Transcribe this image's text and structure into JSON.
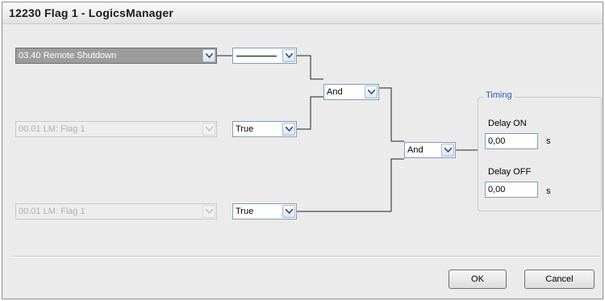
{
  "window": {
    "title": "12230 Flag 1 - LogicsManager"
  },
  "inputs": [
    {
      "value": "03.40 Remote Shutdown",
      "state": "selected"
    },
    {
      "value": "00.01 LM: Flag 1",
      "state": "disabled"
    },
    {
      "value": "00.01 LM: Flag 1",
      "state": "disabled"
    }
  ],
  "operators": [
    {
      "value": ""
    },
    {
      "value": "True"
    },
    {
      "value": "True"
    }
  ],
  "gates": [
    {
      "value": "And"
    },
    {
      "value": "And"
    }
  ],
  "timing": {
    "title": "Timing",
    "delay_on_label": "Delay ON",
    "delay_on_value": "0,00",
    "delay_on_unit": "s",
    "delay_off_label": "Delay OFF",
    "delay_off_value": "0,00",
    "delay_off_unit": "s"
  },
  "buttons": {
    "ok": "OK",
    "cancel": "Cancel"
  },
  "colors": {
    "group_title": "#2a5bb8",
    "selected_input": "#9c9c9c"
  }
}
